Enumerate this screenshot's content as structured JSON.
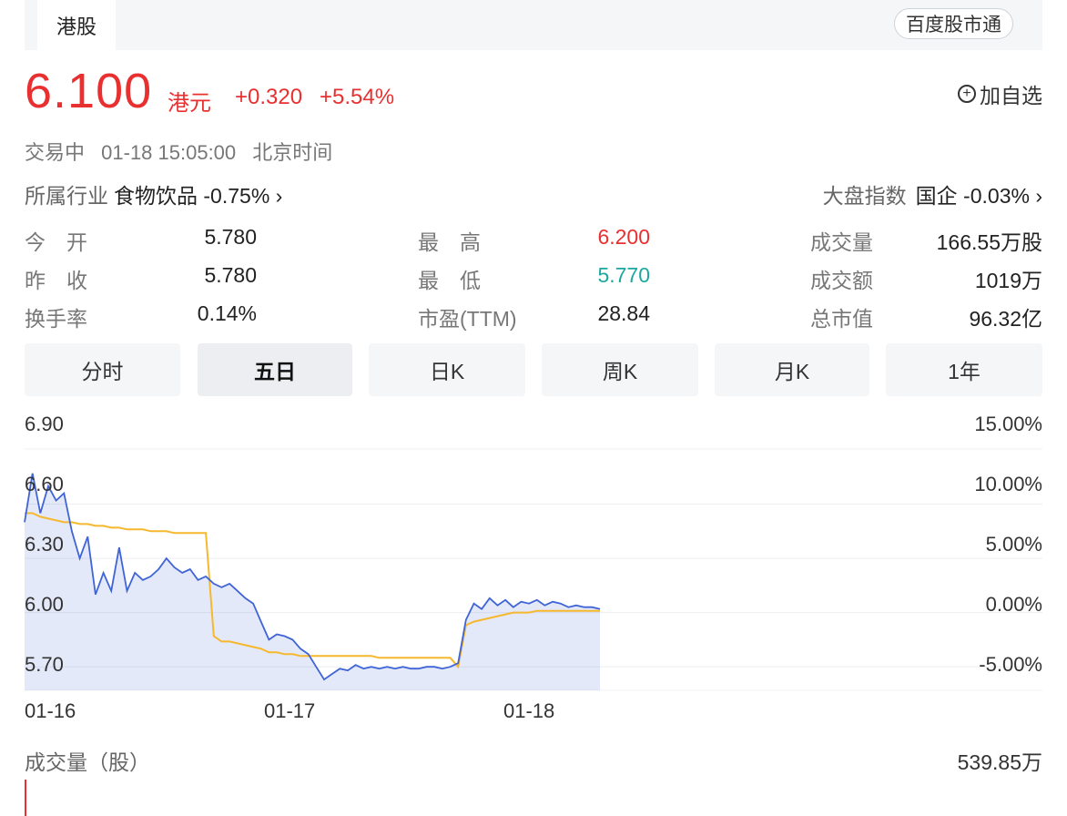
{
  "market_tab": "港股",
  "brand_button": "百度股市通",
  "quote": {
    "price": "6.100",
    "currency": "港元",
    "change": "+0.320",
    "change_pct": "+5.54%"
  },
  "watch_button": "加自选",
  "status": {
    "state": "交易中",
    "time": "01-18 15:05:00",
    "zone": "北京时间"
  },
  "industry": {
    "label": "所属行业",
    "value": "食物饮品 -0.75% ›"
  },
  "index": {
    "label": "大盘指数",
    "value": "国企 -0.03% ›"
  },
  "stats": {
    "open_label": "今　开",
    "open": "5.780",
    "prev_close_label": "昨　收",
    "prev_close": "5.780",
    "turnover_rate_label": "换手率",
    "turnover_rate": "0.14%",
    "high_label": "最　高",
    "high": "6.200",
    "low_label": "最　低",
    "low": "5.770",
    "pe_label": "市盈(TTM)",
    "pe": "28.84",
    "volume_label": "成交量",
    "volume": "166.55万股",
    "amount_label": "成交额",
    "amount": "1019万",
    "mkt_cap_label": "总市值",
    "mkt_cap": "96.32亿"
  },
  "tabs": [
    "分时",
    "五日",
    "日K",
    "周K",
    "月K",
    "1年"
  ],
  "active_tab": "五日",
  "colors": {
    "up": "#e93030",
    "down": "#1ba8a0",
    "price_line": "#3f64d6",
    "avg_line": "#f5b82e"
  },
  "chart_data": {
    "type": "line",
    "x_labels": [
      "01-16",
      "01-17",
      "01-18"
    ],
    "y_ticks_left": [
      "6.90",
      "6.60",
      "6.30",
      "6.00",
      "5.70"
    ],
    "y_ticks_right": [
      "15.00%",
      "10.00%",
      "5.00%",
      "0.00%",
      "-5.00%"
    ],
    "ylim": [
      5.57,
      6.9
    ],
    "base_price": 6.0,
    "grid": true,
    "series": [
      {
        "key": "price",
        "values": [
          6.5,
          6.77,
          6.55,
          6.7,
          6.62,
          6.66,
          6.45,
          6.3,
          6.42,
          6.1,
          6.22,
          6.12,
          6.36,
          6.12,
          6.22,
          6.18,
          6.2,
          6.24,
          6.3,
          6.25,
          6.22,
          6.24,
          6.18,
          6.2,
          6.16,
          6.14,
          6.16,
          6.12,
          6.08,
          6.05,
          5.95,
          5.85,
          5.88,
          5.87,
          5.85,
          5.8,
          5.77,
          5.7,
          5.63,
          5.66,
          5.69,
          5.68,
          5.71,
          5.69,
          5.7,
          5.69,
          5.7,
          5.69,
          5.7,
          5.69,
          5.69,
          5.7,
          5.7,
          5.69,
          5.7,
          5.72,
          5.96,
          6.05,
          6.02,
          6.08,
          6.04,
          6.07,
          6.03,
          6.06,
          6.05,
          6.07,
          6.04,
          6.06,
          6.05,
          6.03,
          6.04,
          6.03,
          6.03,
          6.02
        ]
      },
      {
        "key": "avg",
        "values": [
          6.55,
          6.55,
          6.53,
          6.52,
          6.51,
          6.5,
          6.5,
          6.49,
          6.49,
          6.48,
          6.48,
          6.47,
          6.47,
          6.46,
          6.46,
          6.46,
          6.45,
          6.45,
          6.45,
          6.44,
          6.44,
          6.44,
          6.44,
          6.44,
          5.87,
          5.84,
          5.84,
          5.83,
          5.82,
          5.81,
          5.8,
          5.78,
          5.78,
          5.77,
          5.77,
          5.76,
          5.76,
          5.76,
          5.76,
          5.76,
          5.76,
          5.76,
          5.76,
          5.76,
          5.76,
          5.75,
          5.75,
          5.75,
          5.75,
          5.75,
          5.75,
          5.75,
          5.75,
          5.75,
          5.75,
          5.7,
          5.93,
          5.95,
          5.96,
          5.97,
          5.98,
          5.99,
          6.0,
          6.0,
          6.0,
          6.01,
          6.01,
          6.01,
          6.01,
          6.01,
          6.01,
          6.01,
          6.01,
          6.01
        ]
      }
    ]
  },
  "volume": {
    "label": "成交量（股）",
    "max": "539.85万"
  }
}
